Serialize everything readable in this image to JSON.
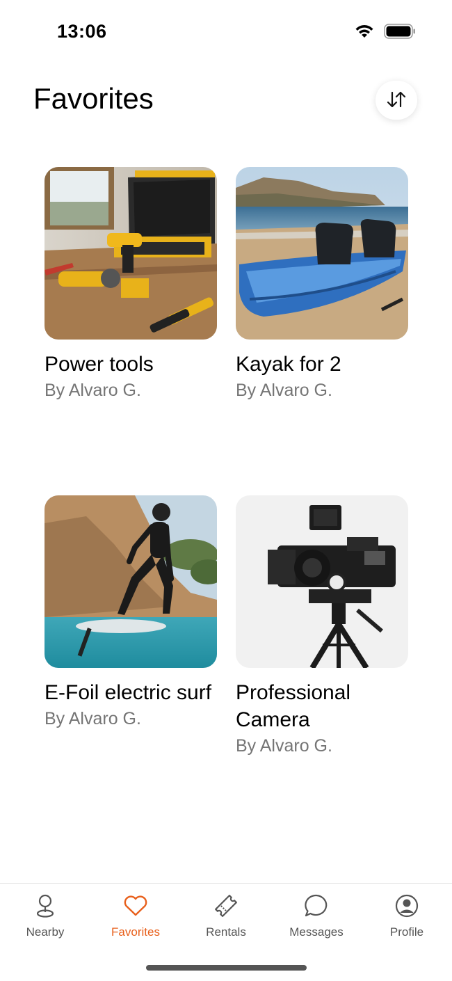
{
  "status_bar": {
    "time": "13:06",
    "icons": [
      "wifi-icon",
      "battery-icon"
    ]
  },
  "header": {
    "title": "Favorites",
    "sort_icon": "sort-icon"
  },
  "favorites": [
    {
      "title": "Power tools",
      "owner": "By Alvaro G.",
      "image": "power-tools-photo"
    },
    {
      "title": "Kayak for 2",
      "owner": "By Alvaro G.",
      "image": "kayak-photo"
    },
    {
      "title": "E-Foil electric surf",
      "owner": "By Alvaro G.",
      "image": "efoil-surf-photo"
    },
    {
      "title": "Professional Camera",
      "owner": "By Alvaro G.",
      "image": "camera-photo"
    }
  ],
  "tab_bar": {
    "active_color": "#e8601c",
    "inactive_color": "#555555",
    "tabs": [
      {
        "label": "Nearby",
        "icon": "location-pin-icon"
      },
      {
        "label": "Favorites",
        "icon": "heart-icon",
        "active": true
      },
      {
        "label": "Rentals",
        "icon": "ticket-icon"
      },
      {
        "label": "Messages",
        "icon": "chat-bubble-icon"
      },
      {
        "label": "Profile",
        "icon": "user-circle-icon"
      }
    ]
  }
}
